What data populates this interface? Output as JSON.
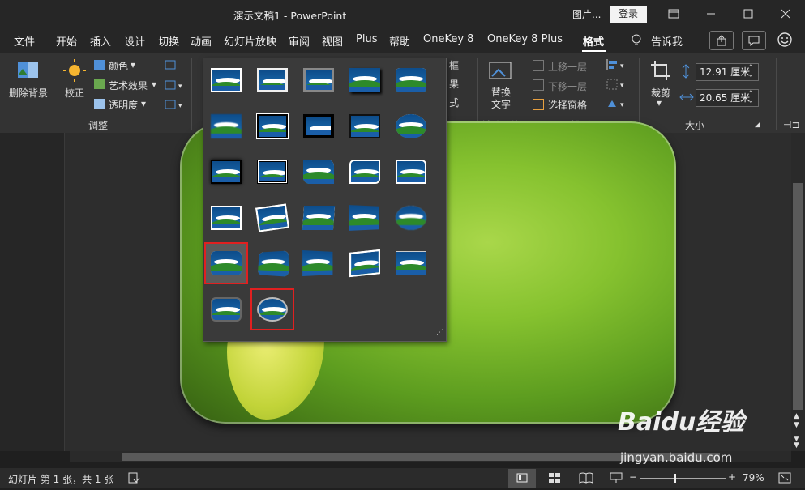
{
  "window": {
    "title": "演示文稿1  -  PowerPoint",
    "context_label": "图片...",
    "login_label": "登录"
  },
  "menu": [
    {
      "label": "文件"
    },
    {
      "label": "开始"
    },
    {
      "label": "插入"
    },
    {
      "label": "设计"
    },
    {
      "label": "切换"
    },
    {
      "label": "动画"
    },
    {
      "label": "幻灯片放映"
    },
    {
      "label": "审阅"
    },
    {
      "label": "视图"
    },
    {
      "label": "Plus"
    },
    {
      "label": "帮助"
    },
    {
      "label": "OneKey 8"
    },
    {
      "label": "OneKey 8 Plus"
    },
    {
      "label": "格式"
    },
    {
      "label": "告诉我"
    }
  ],
  "ribbon": {
    "remove_bg": "删除背景",
    "corrections": "校正",
    "color": "颜色",
    "artistic": "艺术效果",
    "transparency": "透明度",
    "group_adjust": "调整",
    "border_partial": "框",
    "effects_partial": "果",
    "layout_partial": "式",
    "alt_text_1": "替换",
    "alt_text_2": "文字",
    "group_accessibility": "辅助功能",
    "bring_forward": "上移一层",
    "send_backward": "下移一层",
    "selection_pane": "选择窗格",
    "group_arrange": "排列",
    "crop": "裁剪",
    "height": "12.91 厘米",
    "width": "20.65 厘米",
    "group_size": "大小"
  },
  "gallery": {
    "rows": [
      [
        "simple-frame-white",
        "beveled-matte-white",
        "metal-frame",
        "drop-shadow-rectangle",
        "reflected-rounded-rectangle"
      ],
      [
        "soft-edge-rectangle",
        "double-frame-black",
        "thick-matte-black",
        "simple-frame-black",
        "reflected-oval"
      ],
      [
        "center-shadow-rectangle",
        "compound-frame-black",
        "rounded-diagonal-corner",
        "snip-diagonal-corner",
        "moderate-frame-white"
      ],
      [
        "moderate-frame-black",
        "rotated-white",
        "perspective-shadow",
        "relaxed-perspective",
        "soft-edge-oval"
      ],
      [
        "bevel-rectangle",
        "bevel-perspective",
        "reflected-bevel-black",
        "bevel-perspective-left",
        "reflected-bevel-white"
      ],
      [
        "metal-rounded-rectangle",
        "metal-oval"
      ]
    ],
    "selected": [
      [
        4,
        0
      ],
      [
        5,
        1
      ]
    ]
  },
  "status": {
    "slide_info": "幻灯片 第 1 张，共 1 张",
    "zoom": "79%"
  },
  "watermark": {
    "brand": "Baidu经验",
    "url": "jingyan.baidu.com"
  }
}
